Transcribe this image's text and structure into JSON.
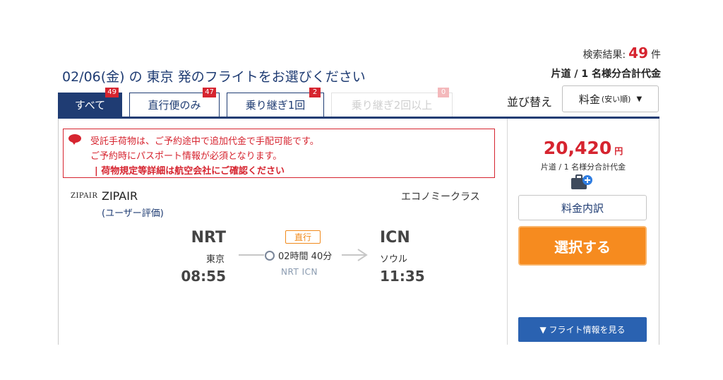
{
  "results": {
    "label": "検索結果:",
    "count": "49",
    "unit": "件"
  },
  "heading": "02/06(金) の 東京 発のフライトをお選びください",
  "total_note": "片道 / 1 名様分合計代金",
  "tabs": [
    {
      "label": "すべて",
      "badge": "49",
      "state": "active"
    },
    {
      "label": "直行便のみ",
      "badge": "47",
      "state": "normal"
    },
    {
      "label": "乗り継ぎ1回",
      "badge": "2",
      "state": "normal"
    },
    {
      "label": "乗り継ぎ2回以上",
      "badge": "0",
      "state": "disabled"
    }
  ],
  "sort": {
    "label": "並び替え",
    "value": "料金",
    "sub": "(安い順)"
  },
  "notice": {
    "lines": [
      "受託手荷物は、ご予約途中で追加代金で手配可能です。",
      "ご予約時にパスポート情報が必須となります。",
      "|  荷物規定等詳細は航空会社にご確認ください"
    ]
  },
  "flight": {
    "logo_text": "ZIPAIR",
    "airline": "ZIPAIR",
    "rating": "(ユーザー評価)",
    "cabin": "エコノミークラス",
    "direct_label": "直行",
    "duration": "02時間 40分",
    "route_codes": "NRT   ICN",
    "departure": {
      "code": "NRT",
      "city": "東京",
      "time": "08:55"
    },
    "arrival": {
      "code": "ICN",
      "city": "ソウル",
      "time": "11:35"
    }
  },
  "fare": {
    "amount": "20,420",
    "currency": "円",
    "note": "片道 / 1 名様分合計代金",
    "breakdown_label": "料金内訳",
    "select_label": "選択する",
    "info_label": "▼ フライト情報を見る"
  },
  "colors": {
    "brand_navy": "#1f3c73",
    "alert_red": "#d6242f",
    "cta_orange": "#f68b1f",
    "info_blue": "#2a62b1"
  },
  "icons": {
    "notice": "speech-bubble-icon",
    "baggage": "baggage-plus-icon",
    "clock": "clock-icon",
    "arrow": "arrow-right-icon",
    "sort_caret": "caret-down-icon"
  }
}
